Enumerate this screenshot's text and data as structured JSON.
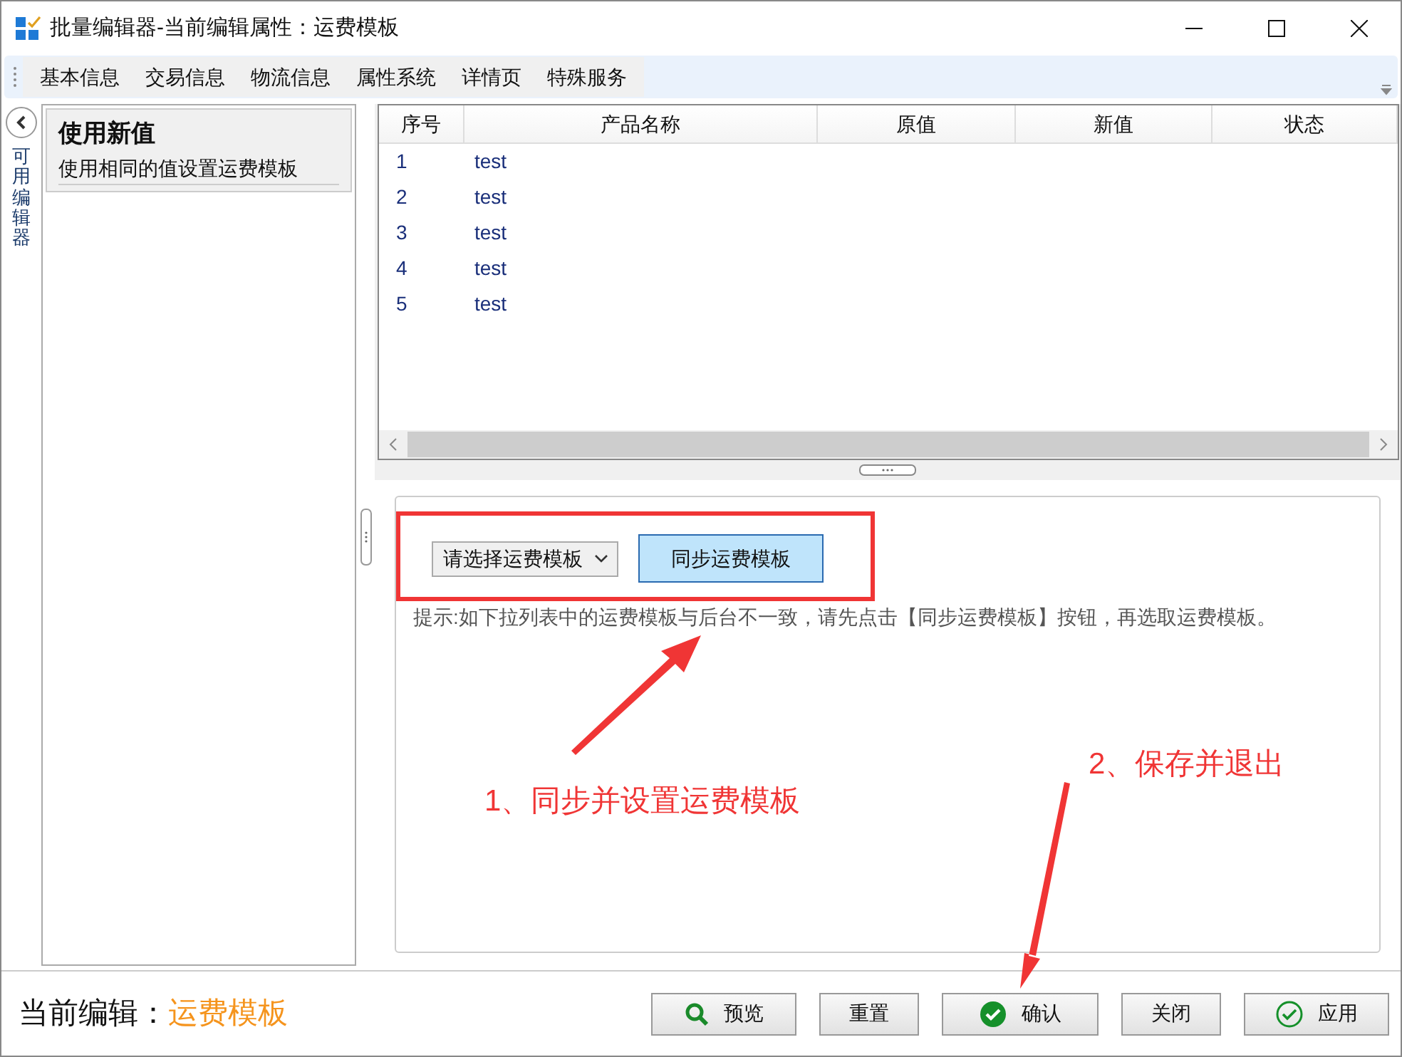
{
  "window": {
    "title": "批量编辑器-当前编辑属性：运费模板"
  },
  "tabs": [
    {
      "label": "基本信息"
    },
    {
      "label": "交易信息"
    },
    {
      "label": "物流信息"
    },
    {
      "label": "属性系统"
    },
    {
      "label": "详情页"
    },
    {
      "label": "特殊服务"
    }
  ],
  "side_strip": {
    "label": "可用编辑器"
  },
  "editor_card": {
    "title": "使用新值",
    "description": "使用相同的值设置运费模板"
  },
  "table": {
    "columns": [
      "序号",
      "产品名称",
      "原值",
      "新值",
      "状态"
    ],
    "rows": [
      {
        "index": "1",
        "name": "test"
      },
      {
        "index": "2",
        "name": "test"
      },
      {
        "index": "3",
        "name": "test"
      },
      {
        "index": "4",
        "name": "test"
      },
      {
        "index": "5",
        "name": "test"
      }
    ]
  },
  "template_select": {
    "value": "请选择运费模板"
  },
  "sync_button": "同步运费模板",
  "hint": "提示:如下拉列表中的运费模板与后台不一致，请先点击【同步运费模板】按钮，再选取运费模板。",
  "current_edit": {
    "label": "当前编辑：",
    "value": "运费模板"
  },
  "buttons": [
    {
      "label": "预览"
    },
    {
      "label": "重置"
    },
    {
      "label": "确认"
    },
    {
      "label": "关闭"
    },
    {
      "label": "应用"
    }
  ],
  "annotations": [
    {
      "text": "1、同步并设置运费模板"
    },
    {
      "text": "2、保存并退出"
    }
  ]
}
